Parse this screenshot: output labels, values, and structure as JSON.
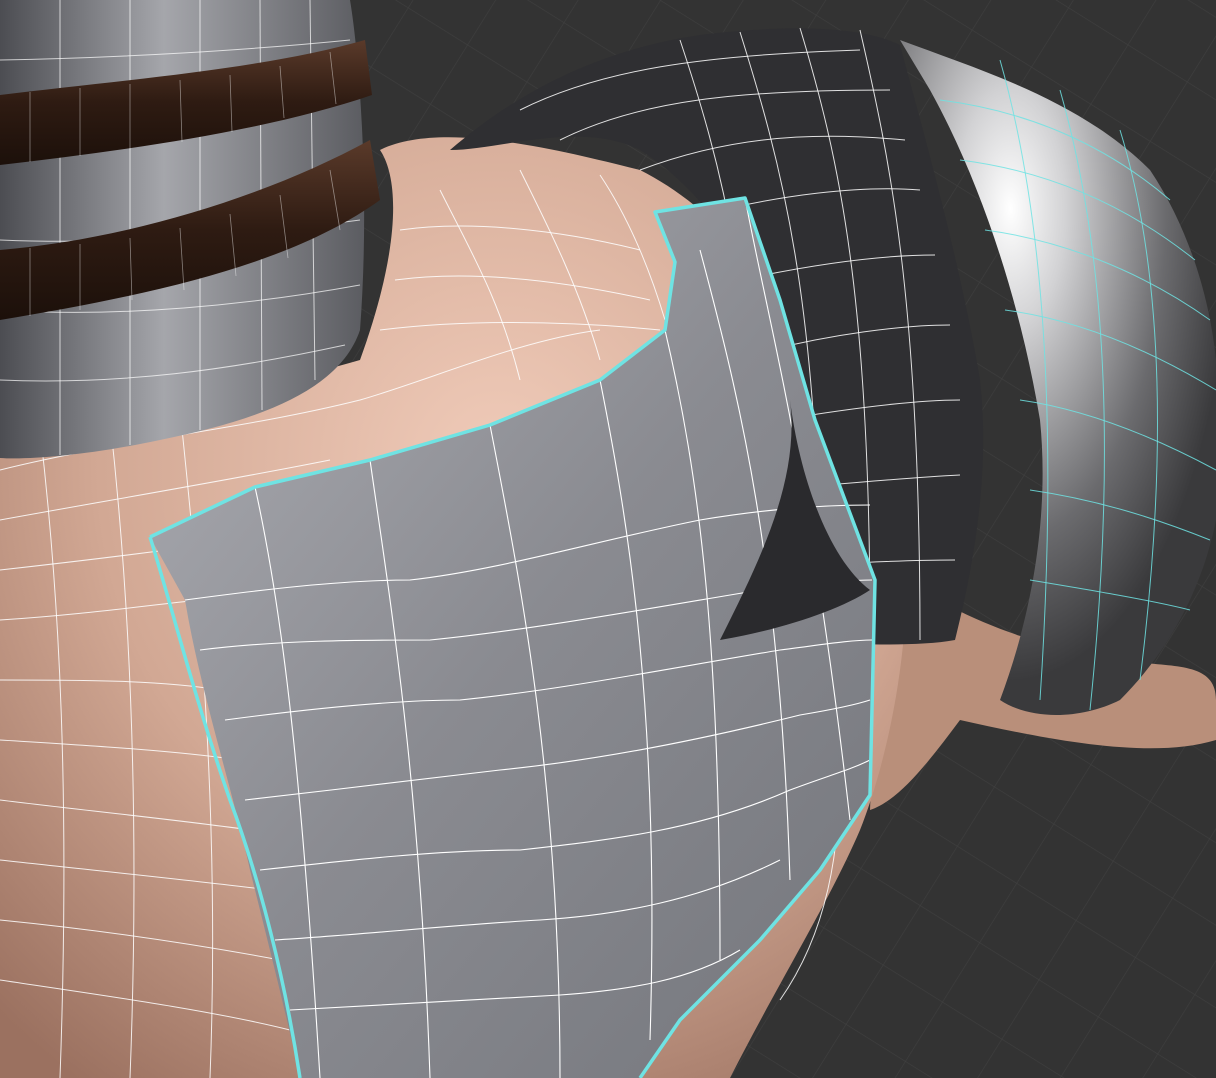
{
  "viewport": {
    "kind": "3d-modeling-viewport",
    "shading": "solid",
    "overlay": "wireframe",
    "selection_highlight": "selected-edges-outline"
  },
  "objects": [
    {
      "id": "neck-armor",
      "role": "collar",
      "color": "#7c7f87"
    },
    {
      "id": "leather-strap-upper",
      "role": "strap",
      "color": "#3a2218"
    },
    {
      "id": "leather-strap-lower",
      "role": "strap",
      "color": "#3a2218"
    },
    {
      "id": "torso-skin",
      "role": "body",
      "color": "#c89b85"
    },
    {
      "id": "chest-plate",
      "role": "armor-plate",
      "color": "#8b8c92",
      "selected": true
    },
    {
      "id": "dark-pauldron",
      "role": "shoulder-armor",
      "color": "#2f2f32"
    },
    {
      "id": "steel-pauldron",
      "role": "shoulder-armor",
      "color": "#b6b6b8"
    },
    {
      "id": "arm-skin",
      "role": "body",
      "color": "#b98f7a"
    }
  ],
  "colors": {
    "background": "#333333",
    "grid_line": "#3e3e3e",
    "wire": "#ffffff",
    "selection": "#6fe3e3",
    "skin_light": "#e9c3b2",
    "skin_dark": "#9e7563",
    "plate_light": "#b3b4ba",
    "plate_dark": "#6d6f76"
  }
}
